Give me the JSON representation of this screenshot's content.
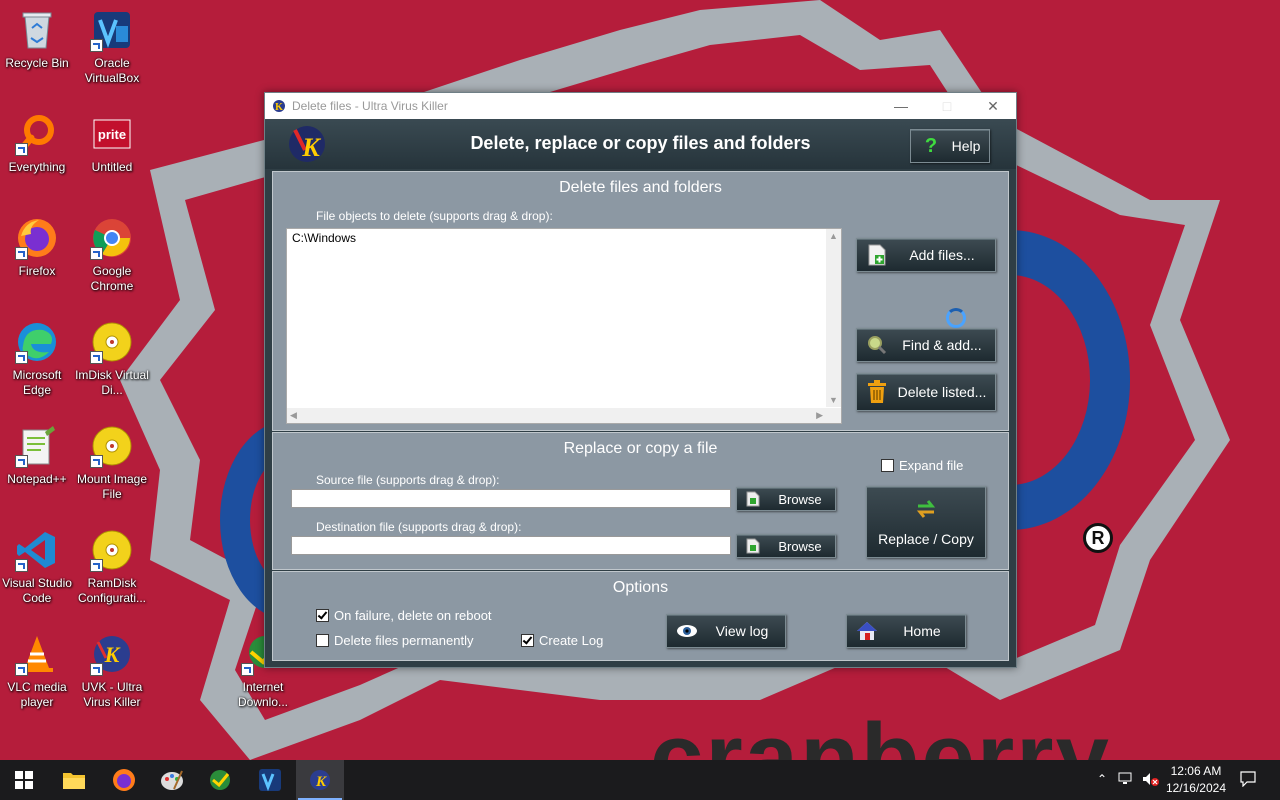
{
  "desktop": {
    "icons": [
      {
        "label": "Recycle Bin"
      },
      {
        "label": "Oracle VirtualBox"
      },
      {
        "label": "Everything"
      },
      {
        "label": "Untitled"
      },
      {
        "label": "Firefox"
      },
      {
        "label": "Google Chrome"
      },
      {
        "label": "Microsoft Edge"
      },
      {
        "label": "ImDisk Virtual Di..."
      },
      {
        "label": "Notepad++"
      },
      {
        "label": "Mount Image File"
      },
      {
        "label": "Visual Studio Code"
      },
      {
        "label": "RamDisk Configurati..."
      },
      {
        "label": "VLC media player"
      },
      {
        "label": "UVK - Ultra Virus Killer"
      },
      {
        "label": "Internet Downlo..."
      }
    ],
    "wallpaper_text": "cranberry",
    "registered_mark": "R"
  },
  "window": {
    "title": "Delete files - Ultra Virus Killer",
    "header_title": "Delete, replace or copy files and folders",
    "help_label": "Help",
    "delete_section": {
      "title": "Delete files and folders",
      "list_label": "File objects to delete (supports drag & drop):",
      "items": [
        "C:\\Windows"
      ],
      "add_files_label": "Add files...",
      "find_add_label": "Find & add...",
      "delete_listed_label": "Delete listed..."
    },
    "replace_section": {
      "title": "Replace or copy a file",
      "source_label": "Source file (supports drag & drop):",
      "source_value": "",
      "dest_label": "Destination file (supports drag & drop):",
      "dest_value": "",
      "browse_label": "Browse",
      "expand_label": "Expand file",
      "expand_checked": false,
      "replace_copy_label": "Replace / Copy"
    },
    "options_section": {
      "title": "Options",
      "on_failure_label": "On failure, delete on reboot",
      "on_failure_checked": true,
      "delete_perm_label": "Delete files permanently",
      "delete_perm_checked": false,
      "create_log_label": "Create Log",
      "create_log_checked": true,
      "view_log_label": "View log",
      "home_label": "Home"
    }
  },
  "taskbar": {
    "time": "12:06 AM",
    "date": "12/16/2024",
    "apps": [
      "start-icon",
      "file-explorer-icon",
      "firefox-icon",
      "paint-icon",
      "idm-icon",
      "virtualbox-icon",
      "uvk-icon"
    ]
  },
  "colors": {
    "desktop_bg": "#b51d3b",
    "window_frame": "#2f3e45",
    "section_bg": "#8c98a3",
    "taskbar_bg": "#1b1b1d"
  }
}
